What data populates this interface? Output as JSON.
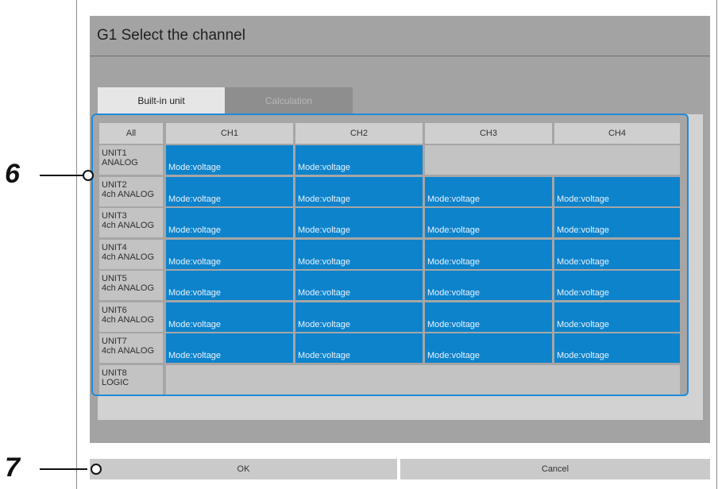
{
  "dialog": {
    "title": "G1  Select the channel"
  },
  "tabs": [
    {
      "label": "Built-in unit",
      "active": true
    },
    {
      "label": "Calculation",
      "active": false
    }
  ],
  "grid": {
    "all_label": "All",
    "columns": [
      "CH1",
      "CH2",
      "CH3",
      "CH4"
    ],
    "cell_text": "Mode:voltage",
    "rows": [
      {
        "line1": "UNIT1",
        "line2": "ANALOG",
        "channels": 2
      },
      {
        "line1": "UNIT2",
        "line2": "4ch ANALOG",
        "channels": 4
      },
      {
        "line1": "UNIT3",
        "line2": "4ch ANALOG",
        "channels": 4
      },
      {
        "line1": "UNIT4",
        "line2": "4ch ANALOG",
        "channels": 4
      },
      {
        "line1": "UNIT5",
        "line2": "4ch ANALOG",
        "channels": 4
      },
      {
        "line1": "UNIT6",
        "line2": "4ch ANALOG",
        "channels": 4
      },
      {
        "line1": "UNIT7",
        "line2": "4ch ANALOG",
        "channels": 4
      },
      {
        "line1": "UNIT8",
        "line2": "LOGIC",
        "channels": 0
      }
    ]
  },
  "buttons": {
    "ok": "OK",
    "cancel": "Cancel"
  },
  "callouts": [
    "6",
    "7"
  ],
  "colors": {
    "selected": "#0d83cc",
    "highlight": "#1e8bdc"
  }
}
